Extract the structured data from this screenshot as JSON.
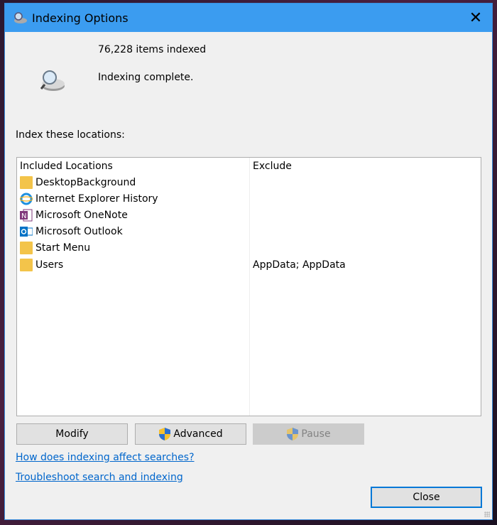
{
  "window": {
    "title": "Indexing Options",
    "close_glyph": "✕"
  },
  "status": {
    "count": "76,228 items indexed",
    "state": "Indexing complete."
  },
  "locations_label": "Index these locations:",
  "table": {
    "headers": {
      "included": "Included Locations",
      "exclude": "Exclude"
    },
    "rows": [
      {
        "name": "DesktopBackground",
        "exclude": "",
        "icon": "folder-icon"
      },
      {
        "name": "Internet Explorer History",
        "exclude": "",
        "icon": "internet-explorer-icon"
      },
      {
        "name": "Microsoft OneNote",
        "exclude": "",
        "icon": "onenote-icon"
      },
      {
        "name": "Microsoft Outlook",
        "exclude": "",
        "icon": "outlook-icon"
      },
      {
        "name": "Start Menu",
        "exclude": "",
        "icon": "folder-icon"
      },
      {
        "name": "Users",
        "exclude": "AppData; AppData",
        "icon": "folder-icon"
      }
    ]
  },
  "buttons": {
    "modify": "Modify",
    "advanced": "Advanced",
    "pause": "Pause",
    "close": "Close"
  },
  "links": {
    "how": "How does indexing affect searches?",
    "troubleshoot": "Troubleshoot search and indexing"
  },
  "colors": {
    "titlebar": "#3b9cf0",
    "link": "#0066cc",
    "focus": "#0078d7"
  }
}
